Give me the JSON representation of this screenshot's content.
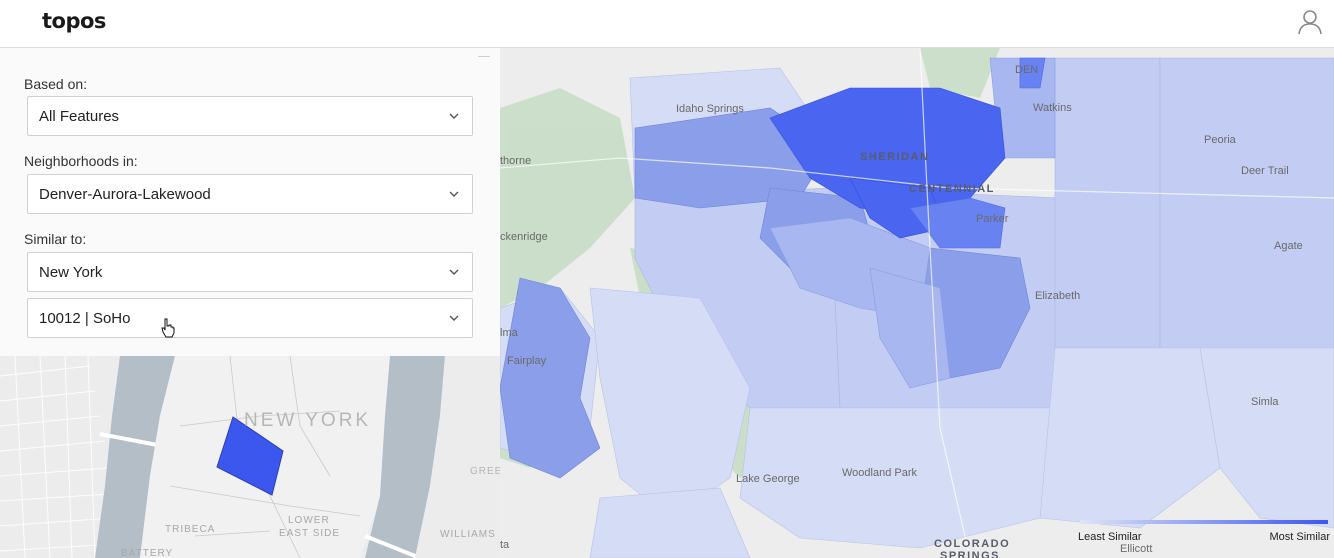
{
  "header": {
    "logo": "topos",
    "user_icon": "user-icon"
  },
  "controls": {
    "based_on": {
      "label": "Based on:",
      "value": "All Features"
    },
    "neighborhoods_in": {
      "label": "Neighborhoods in:",
      "value": "Denver-Aurora-Lakewood"
    },
    "similar_to": {
      "label": "Similar to:",
      "city_value": "New York",
      "neighborhood_value": "10012 | SoHo"
    }
  },
  "mini_map": {
    "labels": {
      "city": "NEW YORK",
      "lower_east_side_1": "LOWER",
      "lower_east_side_2": "EAST SIDE",
      "tribeca": "TRIBECA",
      "battery": "BATTERY",
      "williams": "WILLIAMS",
      "green": "GREEN"
    },
    "highlight_color": "#3b57ee"
  },
  "map": {
    "labels": {
      "denver": "DEN",
      "idaho_springs": "Idaho Springs",
      "thorne": "thorne",
      "watkins": "Watkins",
      "sheridan": "SHERIDAN",
      "centennial": "CENTENNIAL",
      "peoria": "Peoria",
      "deer_trail": "Deer Trail",
      "ckenridge": "ckenridge",
      "parker": "Parker",
      "agate": "Agate",
      "elizabeth": "Elizabeth",
      "lma": "lma",
      "fairplay": "Fairplay",
      "simla": "Simla",
      "woodland_park": "Woodland Park",
      "lake_george": "Lake George",
      "colorado": "COLORADO",
      "springs": "SPRINGS",
      "ellicott": "Ellicott",
      "ta": "ta"
    },
    "colors": {
      "least": "#dfe4f7",
      "most": "#3b57ee"
    }
  },
  "legend": {
    "min_label": "Least Similar",
    "max_label": "Most Similar"
  }
}
